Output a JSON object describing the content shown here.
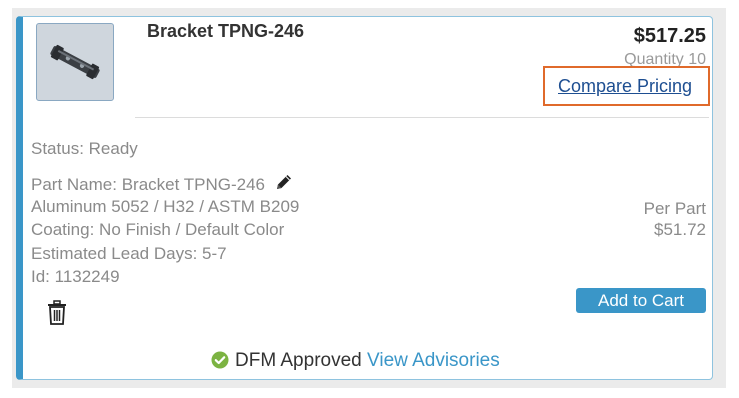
{
  "product": {
    "title": "Bracket TPNG-246",
    "price": "$517.25",
    "quantity": "Quantity 10",
    "compare_pricing": "Compare Pricing"
  },
  "details": {
    "status": "Status:  Ready",
    "part_name": "Part Name:  Bracket TPNG-246",
    "material": "Aluminum 5052 / H32 / ASTM B209",
    "coating": "Coating: No Finish / Default Color",
    "lead_days": "Estimated Lead Days: 5-7",
    "id": "Id: 1132249"
  },
  "pricing": {
    "per_part_label": "Per Part",
    "per_part_value": "$51.72",
    "add_to_cart": "Add to Cart"
  },
  "dfm": {
    "status": "DFM Approved",
    "link": "View Advisories"
  },
  "colors": {
    "accent": "#3a96c8",
    "highlight_border": "#e06a2b",
    "link": "#1d4e91",
    "approved": "#7cb342"
  },
  "icons": {
    "edit": "pencil-icon",
    "delete": "trash-icon",
    "approved": "check-circle-icon",
    "thumbnail": "bracket-part-image"
  }
}
